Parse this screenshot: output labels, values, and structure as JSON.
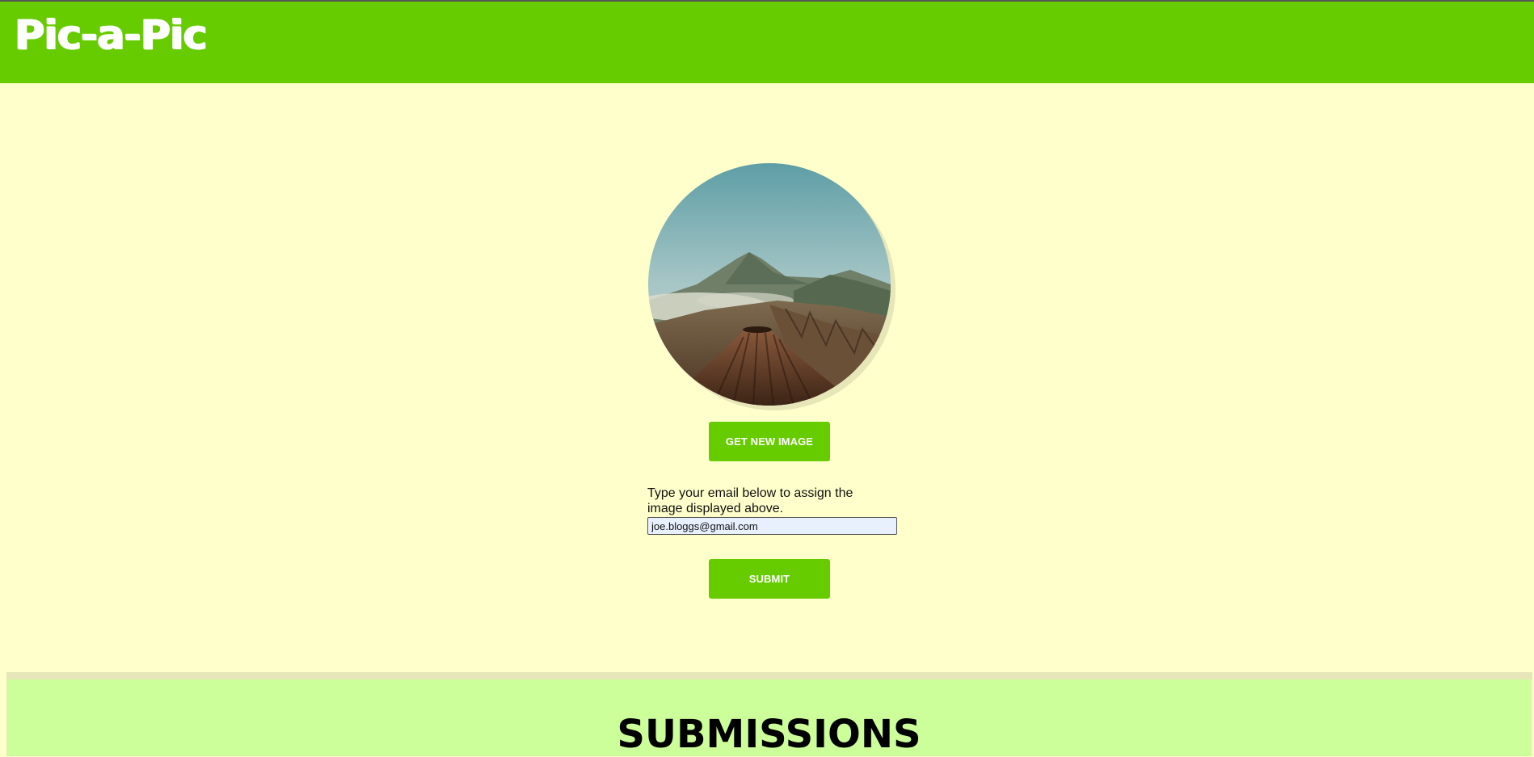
{
  "header": {
    "logo": "Pic-a-Pic"
  },
  "image": {
    "alt": "Mountain volcano landscape"
  },
  "buttons": {
    "get_new_image": "GET NEW IMAGE",
    "submit": "SUBMIT"
  },
  "form": {
    "prompt": "Type your email below to assign the image displayed above.",
    "email_value": "joe.bloggs@gmail.com"
  },
  "submissions": {
    "title": "SUBMISSIONS"
  },
  "colors": {
    "header": "#66cc00",
    "background": "#ffffcc",
    "button": "#66cc00",
    "submissions_bg": "#ccff99"
  }
}
